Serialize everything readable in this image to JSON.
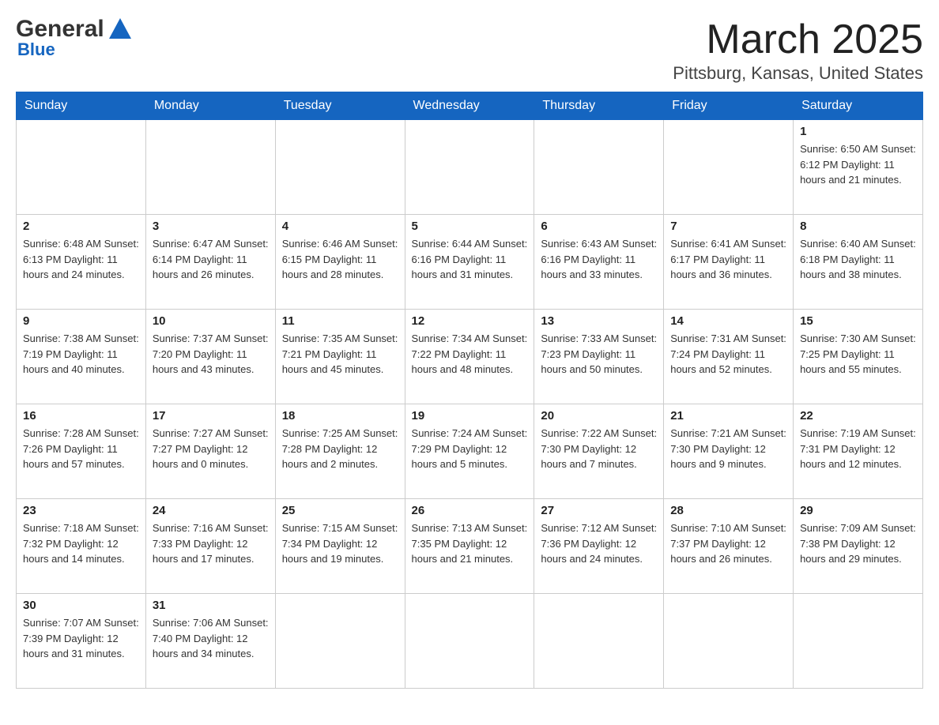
{
  "header": {
    "logo_general": "General",
    "logo_blue": "Blue",
    "month_title": "March 2025",
    "location": "Pittsburg, Kansas, United States"
  },
  "weekdays": [
    "Sunday",
    "Monday",
    "Tuesday",
    "Wednesday",
    "Thursday",
    "Friday",
    "Saturday"
  ],
  "weeks": [
    [
      {
        "day": "",
        "info": ""
      },
      {
        "day": "",
        "info": ""
      },
      {
        "day": "",
        "info": ""
      },
      {
        "day": "",
        "info": ""
      },
      {
        "day": "",
        "info": ""
      },
      {
        "day": "",
        "info": ""
      },
      {
        "day": "1",
        "info": "Sunrise: 6:50 AM\nSunset: 6:12 PM\nDaylight: 11 hours and 21 minutes."
      }
    ],
    [
      {
        "day": "2",
        "info": "Sunrise: 6:48 AM\nSunset: 6:13 PM\nDaylight: 11 hours and 24 minutes."
      },
      {
        "day": "3",
        "info": "Sunrise: 6:47 AM\nSunset: 6:14 PM\nDaylight: 11 hours and 26 minutes."
      },
      {
        "day": "4",
        "info": "Sunrise: 6:46 AM\nSunset: 6:15 PM\nDaylight: 11 hours and 28 minutes."
      },
      {
        "day": "5",
        "info": "Sunrise: 6:44 AM\nSunset: 6:16 PM\nDaylight: 11 hours and 31 minutes."
      },
      {
        "day": "6",
        "info": "Sunrise: 6:43 AM\nSunset: 6:16 PM\nDaylight: 11 hours and 33 minutes."
      },
      {
        "day": "7",
        "info": "Sunrise: 6:41 AM\nSunset: 6:17 PM\nDaylight: 11 hours and 36 minutes."
      },
      {
        "day": "8",
        "info": "Sunrise: 6:40 AM\nSunset: 6:18 PM\nDaylight: 11 hours and 38 minutes."
      }
    ],
    [
      {
        "day": "9",
        "info": "Sunrise: 7:38 AM\nSunset: 7:19 PM\nDaylight: 11 hours and 40 minutes."
      },
      {
        "day": "10",
        "info": "Sunrise: 7:37 AM\nSunset: 7:20 PM\nDaylight: 11 hours and 43 minutes."
      },
      {
        "day": "11",
        "info": "Sunrise: 7:35 AM\nSunset: 7:21 PM\nDaylight: 11 hours and 45 minutes."
      },
      {
        "day": "12",
        "info": "Sunrise: 7:34 AM\nSunset: 7:22 PM\nDaylight: 11 hours and 48 minutes."
      },
      {
        "day": "13",
        "info": "Sunrise: 7:33 AM\nSunset: 7:23 PM\nDaylight: 11 hours and 50 minutes."
      },
      {
        "day": "14",
        "info": "Sunrise: 7:31 AM\nSunset: 7:24 PM\nDaylight: 11 hours and 52 minutes."
      },
      {
        "day": "15",
        "info": "Sunrise: 7:30 AM\nSunset: 7:25 PM\nDaylight: 11 hours and 55 minutes."
      }
    ],
    [
      {
        "day": "16",
        "info": "Sunrise: 7:28 AM\nSunset: 7:26 PM\nDaylight: 11 hours and 57 minutes."
      },
      {
        "day": "17",
        "info": "Sunrise: 7:27 AM\nSunset: 7:27 PM\nDaylight: 12 hours and 0 minutes."
      },
      {
        "day": "18",
        "info": "Sunrise: 7:25 AM\nSunset: 7:28 PM\nDaylight: 12 hours and 2 minutes."
      },
      {
        "day": "19",
        "info": "Sunrise: 7:24 AM\nSunset: 7:29 PM\nDaylight: 12 hours and 5 minutes."
      },
      {
        "day": "20",
        "info": "Sunrise: 7:22 AM\nSunset: 7:30 PM\nDaylight: 12 hours and 7 minutes."
      },
      {
        "day": "21",
        "info": "Sunrise: 7:21 AM\nSunset: 7:30 PM\nDaylight: 12 hours and 9 minutes."
      },
      {
        "day": "22",
        "info": "Sunrise: 7:19 AM\nSunset: 7:31 PM\nDaylight: 12 hours and 12 minutes."
      }
    ],
    [
      {
        "day": "23",
        "info": "Sunrise: 7:18 AM\nSunset: 7:32 PM\nDaylight: 12 hours and 14 minutes."
      },
      {
        "day": "24",
        "info": "Sunrise: 7:16 AM\nSunset: 7:33 PM\nDaylight: 12 hours and 17 minutes."
      },
      {
        "day": "25",
        "info": "Sunrise: 7:15 AM\nSunset: 7:34 PM\nDaylight: 12 hours and 19 minutes."
      },
      {
        "day": "26",
        "info": "Sunrise: 7:13 AM\nSunset: 7:35 PM\nDaylight: 12 hours and 21 minutes."
      },
      {
        "day": "27",
        "info": "Sunrise: 7:12 AM\nSunset: 7:36 PM\nDaylight: 12 hours and 24 minutes."
      },
      {
        "day": "28",
        "info": "Sunrise: 7:10 AM\nSunset: 7:37 PM\nDaylight: 12 hours and 26 minutes."
      },
      {
        "day": "29",
        "info": "Sunrise: 7:09 AM\nSunset: 7:38 PM\nDaylight: 12 hours and 29 minutes."
      }
    ],
    [
      {
        "day": "30",
        "info": "Sunrise: 7:07 AM\nSunset: 7:39 PM\nDaylight: 12 hours and 31 minutes."
      },
      {
        "day": "31",
        "info": "Sunrise: 7:06 AM\nSunset: 7:40 PM\nDaylight: 12 hours and 34 minutes."
      },
      {
        "day": "",
        "info": ""
      },
      {
        "day": "",
        "info": ""
      },
      {
        "day": "",
        "info": ""
      },
      {
        "day": "",
        "info": ""
      },
      {
        "day": "",
        "info": ""
      }
    ]
  ]
}
